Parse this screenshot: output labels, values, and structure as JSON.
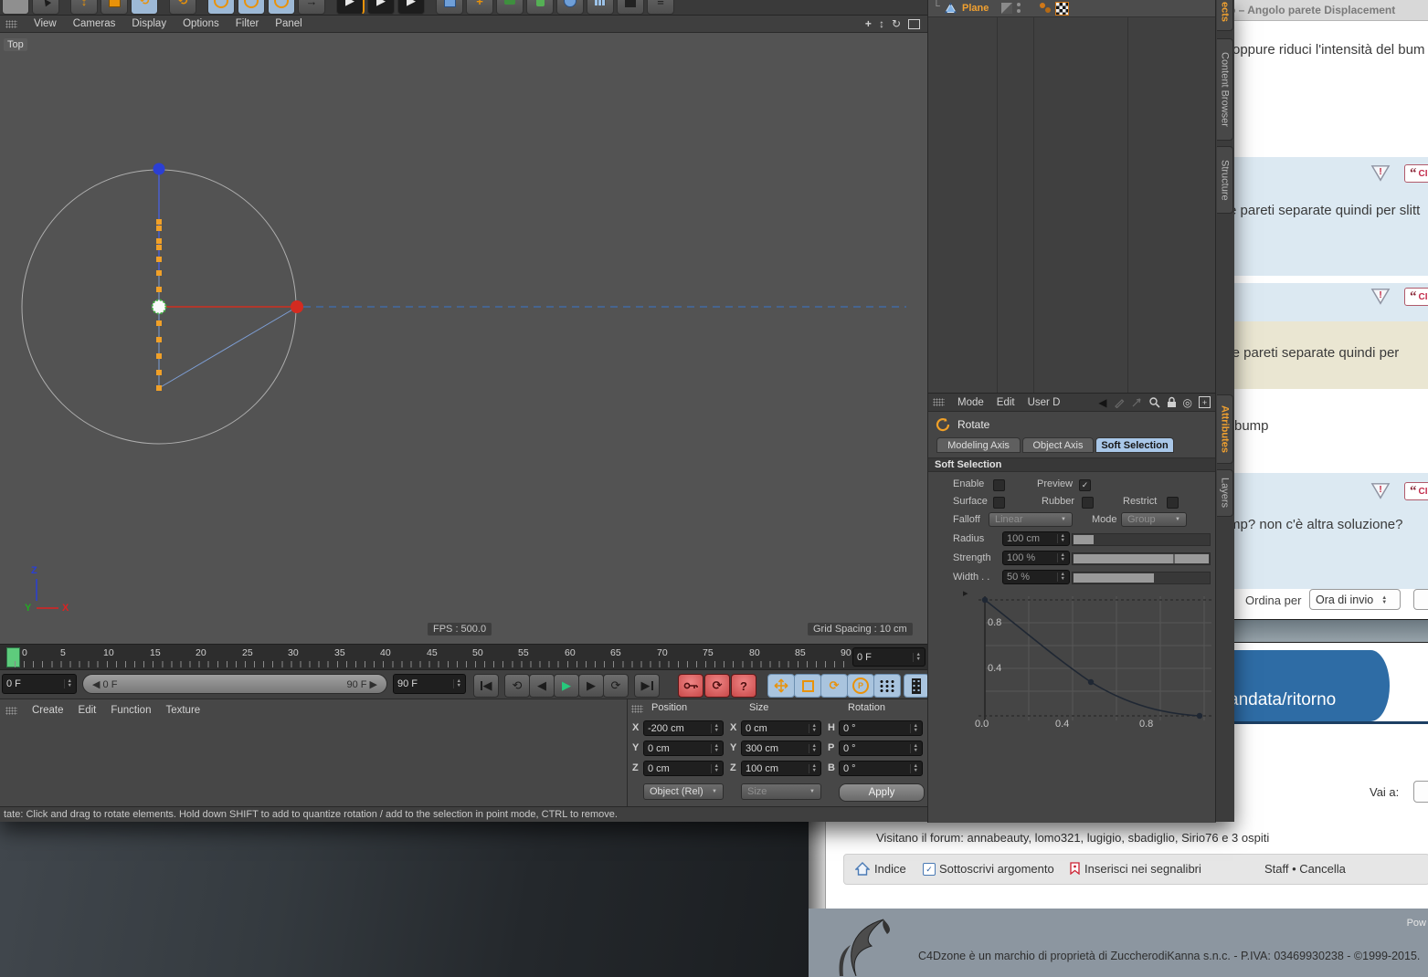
{
  "icons": {
    "check": "✓",
    "goto_start": "◀",
    "prev_key": "⟲",
    "prev_frame": "◀",
    "play": "▶",
    "next_frame": "▶",
    "next_key": "⟳",
    "goto_end": "▶",
    "autokey": "⟳",
    "question": "?",
    "small_left": "◀",
    "small_right": "▶",
    "pan": "+",
    "zoom_view": "↕",
    "rotate_view": "↻",
    "maximize": "❒",
    "back": "◀",
    "target": "◎",
    "expand": "▸",
    "house": "⌂",
    "rotate_chip": "⟲",
    "tree_branch": "└",
    "play_render": "▶",
    "menu_grip": "≡"
  },
  "c4d": {
    "viewport_menu": {
      "items": [
        "View",
        "Cameras",
        "Display",
        "Options",
        "Filter",
        "Panel"
      ]
    },
    "viewport": {
      "label": "Top",
      "fps": "FPS : 500.0",
      "grid": "Grid Spacing : 10 cm",
      "axis": {
        "x": "X",
        "y": "Y",
        "z": "Z"
      }
    },
    "timeline": {
      "ticks": [
        "0",
        "5",
        "10",
        "15",
        "20",
        "25",
        "30",
        "35",
        "40",
        "45",
        "50",
        "55",
        "60",
        "65",
        "70",
        "75",
        "80",
        "85",
        "90"
      ],
      "current": "0 F",
      "range_start": "0 F",
      "range_end": "90 F",
      "end": "90 F",
      "ruler_current": "0 F"
    },
    "timeline_menu": {
      "items": [
        "Create",
        "Edit",
        "Function",
        "Texture"
      ]
    },
    "coordinates": {
      "position_title": "Position",
      "size_title": "Size",
      "rotation_title": "Rotation",
      "row_labels": {
        "x": "X",
        "y": "Y",
        "z": "Z",
        "h": "H",
        "p": "P",
        "b": "B"
      },
      "pos_x": "-200 cm",
      "pos_y": "0 cm",
      "pos_z": "0 cm",
      "size_x": "0 cm",
      "size_y": "300 cm",
      "size_z": "100 cm",
      "rot_h": "0 °",
      "rot_p": "0 °",
      "rot_b": "0 °",
      "object_mode": "Object (Rel)",
      "size_mode": "Size",
      "apply": "Apply"
    },
    "status": "tate: Click and drag to rotate elements. Hold down SHIFT to add to quantize rotation / add to the selection in point mode, CTRL to remove.",
    "objects": {
      "item": "Plane"
    },
    "side_tabs": {
      "t0": "ects",
      "t1": "Content Browser",
      "t2": "Structure",
      "b0": "Attributes",
      "b1": "Layers"
    },
    "attributes": {
      "menu": [
        "Mode",
        "Edit",
        "User D"
      ],
      "tool": "Rotate",
      "tabs": [
        "Modeling Axis",
        "Object Axis",
        "Soft Selection"
      ],
      "section": "Soft Selection",
      "enable": "Enable",
      "preview": "Preview",
      "surface": "Surface",
      "rubber": "Rubber",
      "restrict": "Restrict",
      "falloff": "Falloff",
      "falloff_value": "Linear",
      "mode": "Mode",
      "mode_value": "Group",
      "radius": "Radius",
      "radius_value": "100 cm",
      "strength": "Strength",
      "strength_value": "100 %",
      "width": "Width . .",
      "width_value": "50 %",
      "curve": {
        "type": "line",
        "points": [
          [
            0.0,
            1.0
          ],
          [
            0.5,
            0.3
          ],
          [
            1.0,
            0.0
          ]
        ],
        "x_ticks": {
          "x1": "0.0",
          "x2": "0.4",
          "x3": "0.8"
        },
        "y_ticks": {
          "y1": "0.8",
          "y2": "0.4"
        }
      }
    }
  },
  "forum": {
    "tab_title": "to – Angolo parete Displacement",
    "posts": {
      "p1": "oppure riduci l'intensità del bum",
      "p2": "e pareti separate quindi per slitt",
      "p3": "lle pareti separate quindi per",
      "bump": "bump",
      "p4": "mp? non c'è altra soluzione?"
    },
    "quote_label": "CI",
    "sort_label": "Ordina per",
    "sort_value": "Ora di invio",
    "banner": "andata/ritorno",
    "goto_label": "Vai a:",
    "visitors": "Visitano il forum: annabeauty, lomo321, lugigio, sbadiglio, Sirio76 e 3 ospiti",
    "actions": {
      "index": "Indice",
      "subscribe": "Sottoscrivi argomento",
      "bookmark": "Inserisci nei segnalibri",
      "staff": "Staff • Cancella"
    },
    "powered": "Pow",
    "footer": "C4Dzone è un marchio di proprietà di ZuccherodiKanna s.n.c. - P.IVA: 03469930238 - ©1999-2015."
  }
}
